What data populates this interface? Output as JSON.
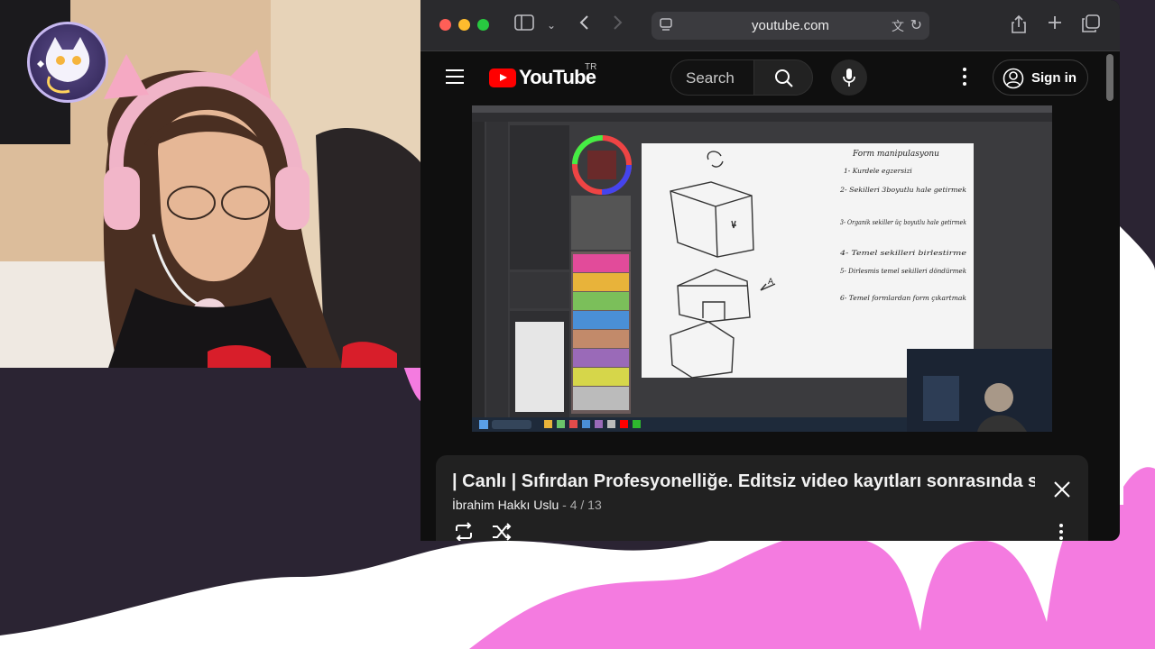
{
  "browser": {
    "url": "youtube.com",
    "traffic_lights": [
      "close",
      "minimize",
      "zoom"
    ],
    "colors": {
      "titlebar": "#2a2a2d",
      "page": "#0f0f0f"
    }
  },
  "youtube": {
    "logo_text": "YouTube",
    "country_code": "TR",
    "search_placeholder": "Search",
    "sign_in_label": "Sign in",
    "accent": "#ff0000"
  },
  "video": {
    "whiteboard_title": "Form manipulasyonu",
    "whiteboard_lines": [
      "1- Kurdele egzersizi",
      "2- Sekilleri 3boyutlu hale getirmek",
      "3- Organik sekiller üç boyutlu hale getirmek",
      "4- Temel sekilleri birlestirme",
      "5- Dirlesmis temel sekilleri döndürmek",
      "6- Temel formlardan form çıkartmak"
    ],
    "label_a": "A"
  },
  "playlist": {
    "title": "| Canlı |  Sıfırdan  Profesyonelliğe. Editsiz video kayıtları sonrasında s",
    "channel": "İbrahim Hakkı Uslu",
    "separator": " - ",
    "position": "4 / 13"
  },
  "icons": {
    "sidebar": "sidebar-icon",
    "back": "back-icon",
    "forward": "forward-icon",
    "share": "share-icon",
    "new_tab": "plus-icon",
    "tabs": "tabs-icon",
    "search": "search-icon",
    "mic": "mic-icon",
    "loop": "loop-icon",
    "shuffle": "shuffle-icon",
    "close": "close-icon"
  }
}
